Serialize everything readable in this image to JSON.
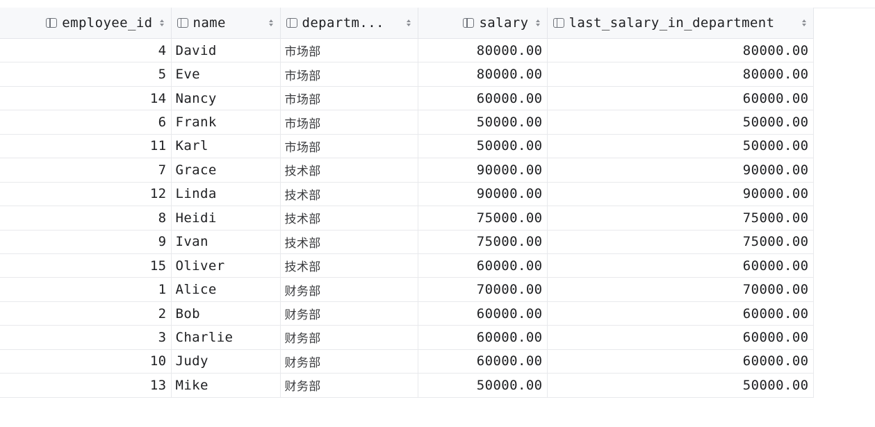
{
  "columns": [
    {
      "key": "employee_id",
      "label": "employee_id"
    },
    {
      "key": "name",
      "label": "name"
    },
    {
      "key": "department",
      "label": "departm..."
    },
    {
      "key": "salary",
      "label": "salary"
    },
    {
      "key": "last_salary_in_department",
      "label": "last_salary_in_department"
    }
  ],
  "rows": [
    {
      "employee_id": "4",
      "name": "David",
      "department": "市场部",
      "salary": "80000.00",
      "last_salary_in_department": "80000.00"
    },
    {
      "employee_id": "5",
      "name": "Eve",
      "department": "市场部",
      "salary": "80000.00",
      "last_salary_in_department": "80000.00"
    },
    {
      "employee_id": "14",
      "name": "Nancy",
      "department": "市场部",
      "salary": "60000.00",
      "last_salary_in_department": "60000.00"
    },
    {
      "employee_id": "6",
      "name": "Frank",
      "department": "市场部",
      "salary": "50000.00",
      "last_salary_in_department": "50000.00"
    },
    {
      "employee_id": "11",
      "name": "Karl",
      "department": "市场部",
      "salary": "50000.00",
      "last_salary_in_department": "50000.00"
    },
    {
      "employee_id": "7",
      "name": "Grace",
      "department": "技术部",
      "salary": "90000.00",
      "last_salary_in_department": "90000.00"
    },
    {
      "employee_id": "12",
      "name": "Linda",
      "department": "技术部",
      "salary": "90000.00",
      "last_salary_in_department": "90000.00"
    },
    {
      "employee_id": "8",
      "name": "Heidi",
      "department": "技术部",
      "salary": "75000.00",
      "last_salary_in_department": "75000.00"
    },
    {
      "employee_id": "9",
      "name": "Ivan",
      "department": "技术部",
      "salary": "75000.00",
      "last_salary_in_department": "75000.00"
    },
    {
      "employee_id": "15",
      "name": "Oliver",
      "department": "技术部",
      "salary": "60000.00",
      "last_salary_in_department": "60000.00"
    },
    {
      "employee_id": "1",
      "name": "Alice",
      "department": "财务部",
      "salary": "70000.00",
      "last_salary_in_department": "70000.00"
    },
    {
      "employee_id": "2",
      "name": "Bob",
      "department": "财务部",
      "salary": "60000.00",
      "last_salary_in_department": "60000.00"
    },
    {
      "employee_id": "3",
      "name": "Charlie",
      "department": "财务部",
      "salary": "60000.00",
      "last_salary_in_department": "60000.00"
    },
    {
      "employee_id": "10",
      "name": "Judy",
      "department": "财务部",
      "salary": "60000.00",
      "last_salary_in_department": "60000.00"
    },
    {
      "employee_id": "13",
      "name": "Mike",
      "department": "财务部",
      "salary": "50000.00",
      "last_salary_in_department": "50000.00"
    }
  ],
  "icons": {
    "column_type": "column-icon",
    "sort": "sort-icon"
  },
  "colors": {
    "header_bg": "#f7f8fa",
    "grid_line": "#e8e9ec",
    "text": "#1e1f22"
  }
}
